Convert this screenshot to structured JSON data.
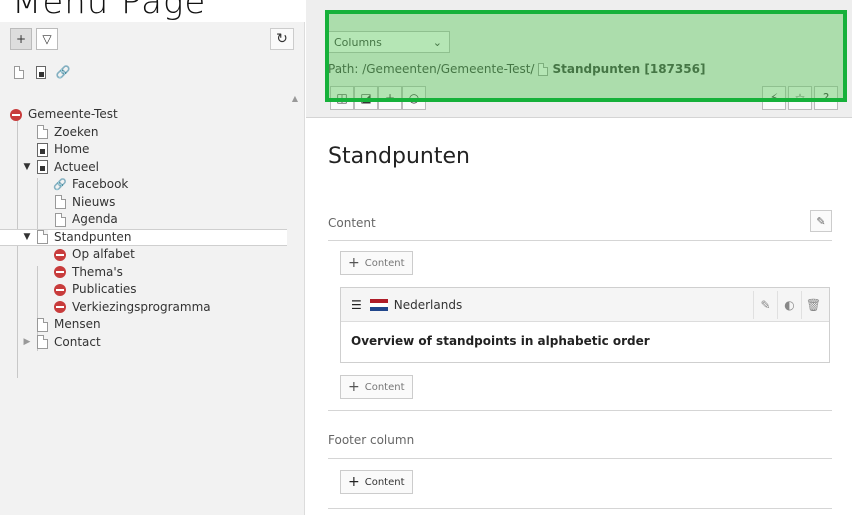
{
  "heading_overlay": "Menu Page",
  "left_panel": {
    "toolbar": {
      "new_page_icon": "new-page-icon",
      "filter_icon": "filter-icon",
      "refresh_icon": "refresh-icon"
    },
    "tree": [
      {
        "label": "Gemeente-Test",
        "icon": "site-root",
        "depth": 0
      },
      {
        "label": "Zoeken",
        "icon": "page",
        "depth": 1
      },
      {
        "label": "Home",
        "icon": "home",
        "depth": 1
      },
      {
        "label": "Actueel",
        "icon": "home",
        "depth": 1,
        "expanded": true
      },
      {
        "label": "Facebook",
        "icon": "link",
        "depth": 2
      },
      {
        "label": "Nieuws",
        "icon": "page",
        "depth": 2
      },
      {
        "label": "Agenda",
        "icon": "page",
        "depth": 2
      },
      {
        "label": "Standpunten",
        "icon": "page",
        "depth": 1,
        "expanded": true,
        "selected": true
      },
      {
        "label": "Op alfabet",
        "icon": "restricted",
        "depth": 2
      },
      {
        "label": "Thema's",
        "icon": "restricted",
        "depth": 2
      },
      {
        "label": "Publicaties",
        "icon": "restricted",
        "depth": 2
      },
      {
        "label": "Verkiezingsprogramma",
        "icon": "restricted",
        "depth": 2
      },
      {
        "label": "Mensen",
        "icon": "page",
        "depth": 1
      },
      {
        "label": "Contact",
        "icon": "page",
        "depth": 1,
        "collapsed": true
      }
    ]
  },
  "docheader": {
    "view_select": "Columns",
    "path_label": "Path: /Gemeenten/Gemeente-Test/",
    "path_page": "Standpunten [187356]"
  },
  "main": {
    "title": "Standpunten",
    "content_label": "Content",
    "add_content_label": "Content",
    "element": {
      "language": "Nederlands",
      "text": "Overview of standpoints in alphabetic order"
    },
    "footer_label": "Footer column"
  },
  "colors": {
    "highlight": "#16b13a",
    "restricted": "#c83c3c"
  }
}
